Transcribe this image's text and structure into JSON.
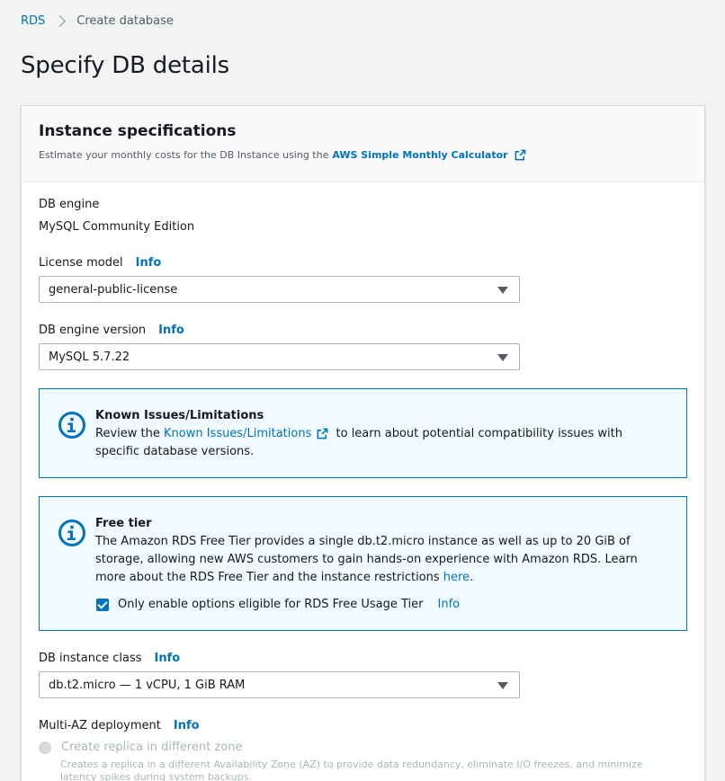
{
  "breadcrumb": {
    "items": [
      "RDS",
      "Create database"
    ]
  },
  "page": {
    "title": "Specify DB details"
  },
  "panel": {
    "title": "Instance specifications",
    "desc_prefix": "Estimate your monthly costs for the DB Instance using the",
    "desc_link": "AWS Simple Monthly Calculator"
  },
  "db_engine": {
    "label": "DB engine",
    "value": "MySQL Community Edition"
  },
  "license_model": {
    "label": "License model",
    "info": "Info",
    "value": "general-public-license"
  },
  "engine_version": {
    "label": "DB engine version",
    "info": "Info",
    "value": "MySQL 5.7.22"
  },
  "known_issues": {
    "title": "Known Issues/Limitations",
    "text_prefix": "Review the",
    "link": "Known Issues/Limitations",
    "text_suffix": "to learn about potential compatibility issues with specific database versions."
  },
  "free_tier": {
    "title": "Free tier",
    "text": "The Amazon RDS Free Tier provides a single db.t2.micro instance as well as up to 20 GiB of storage, allowing new AWS customers to gain hands-on experience with Amazon RDS. Learn more about the RDS Free Tier and the instance restrictions",
    "link": "here",
    "period": ".",
    "checkbox_label": "Only enable options eligible for RDS Free Usage Tier",
    "checkbox_checked": true,
    "checkbox_info": "Info"
  },
  "instance_class": {
    "label": "DB instance class",
    "info": "Info",
    "value": "db.t2.micro — 1 vCPU, 1 GiB RAM"
  },
  "multi_az": {
    "label": "Multi-AZ deployment",
    "info": "Info",
    "option_label": "Create replica in different zone",
    "option_desc": "Creates a replica in a different Availability Zone (AZ) to provide data redundancy, eliminate I/O freezes, and minimize latency spikes during system backups."
  },
  "colors": {
    "accent": "#0073bb",
    "alert_bg": "#f1faff",
    "text": "#16191f",
    "muted": "#545b64",
    "disabled": "#aab7b8"
  },
  "icons": {
    "external_link": "external-link-icon",
    "info_alert": "info-circle-icon",
    "dropdown": "caret-down-icon"
  }
}
